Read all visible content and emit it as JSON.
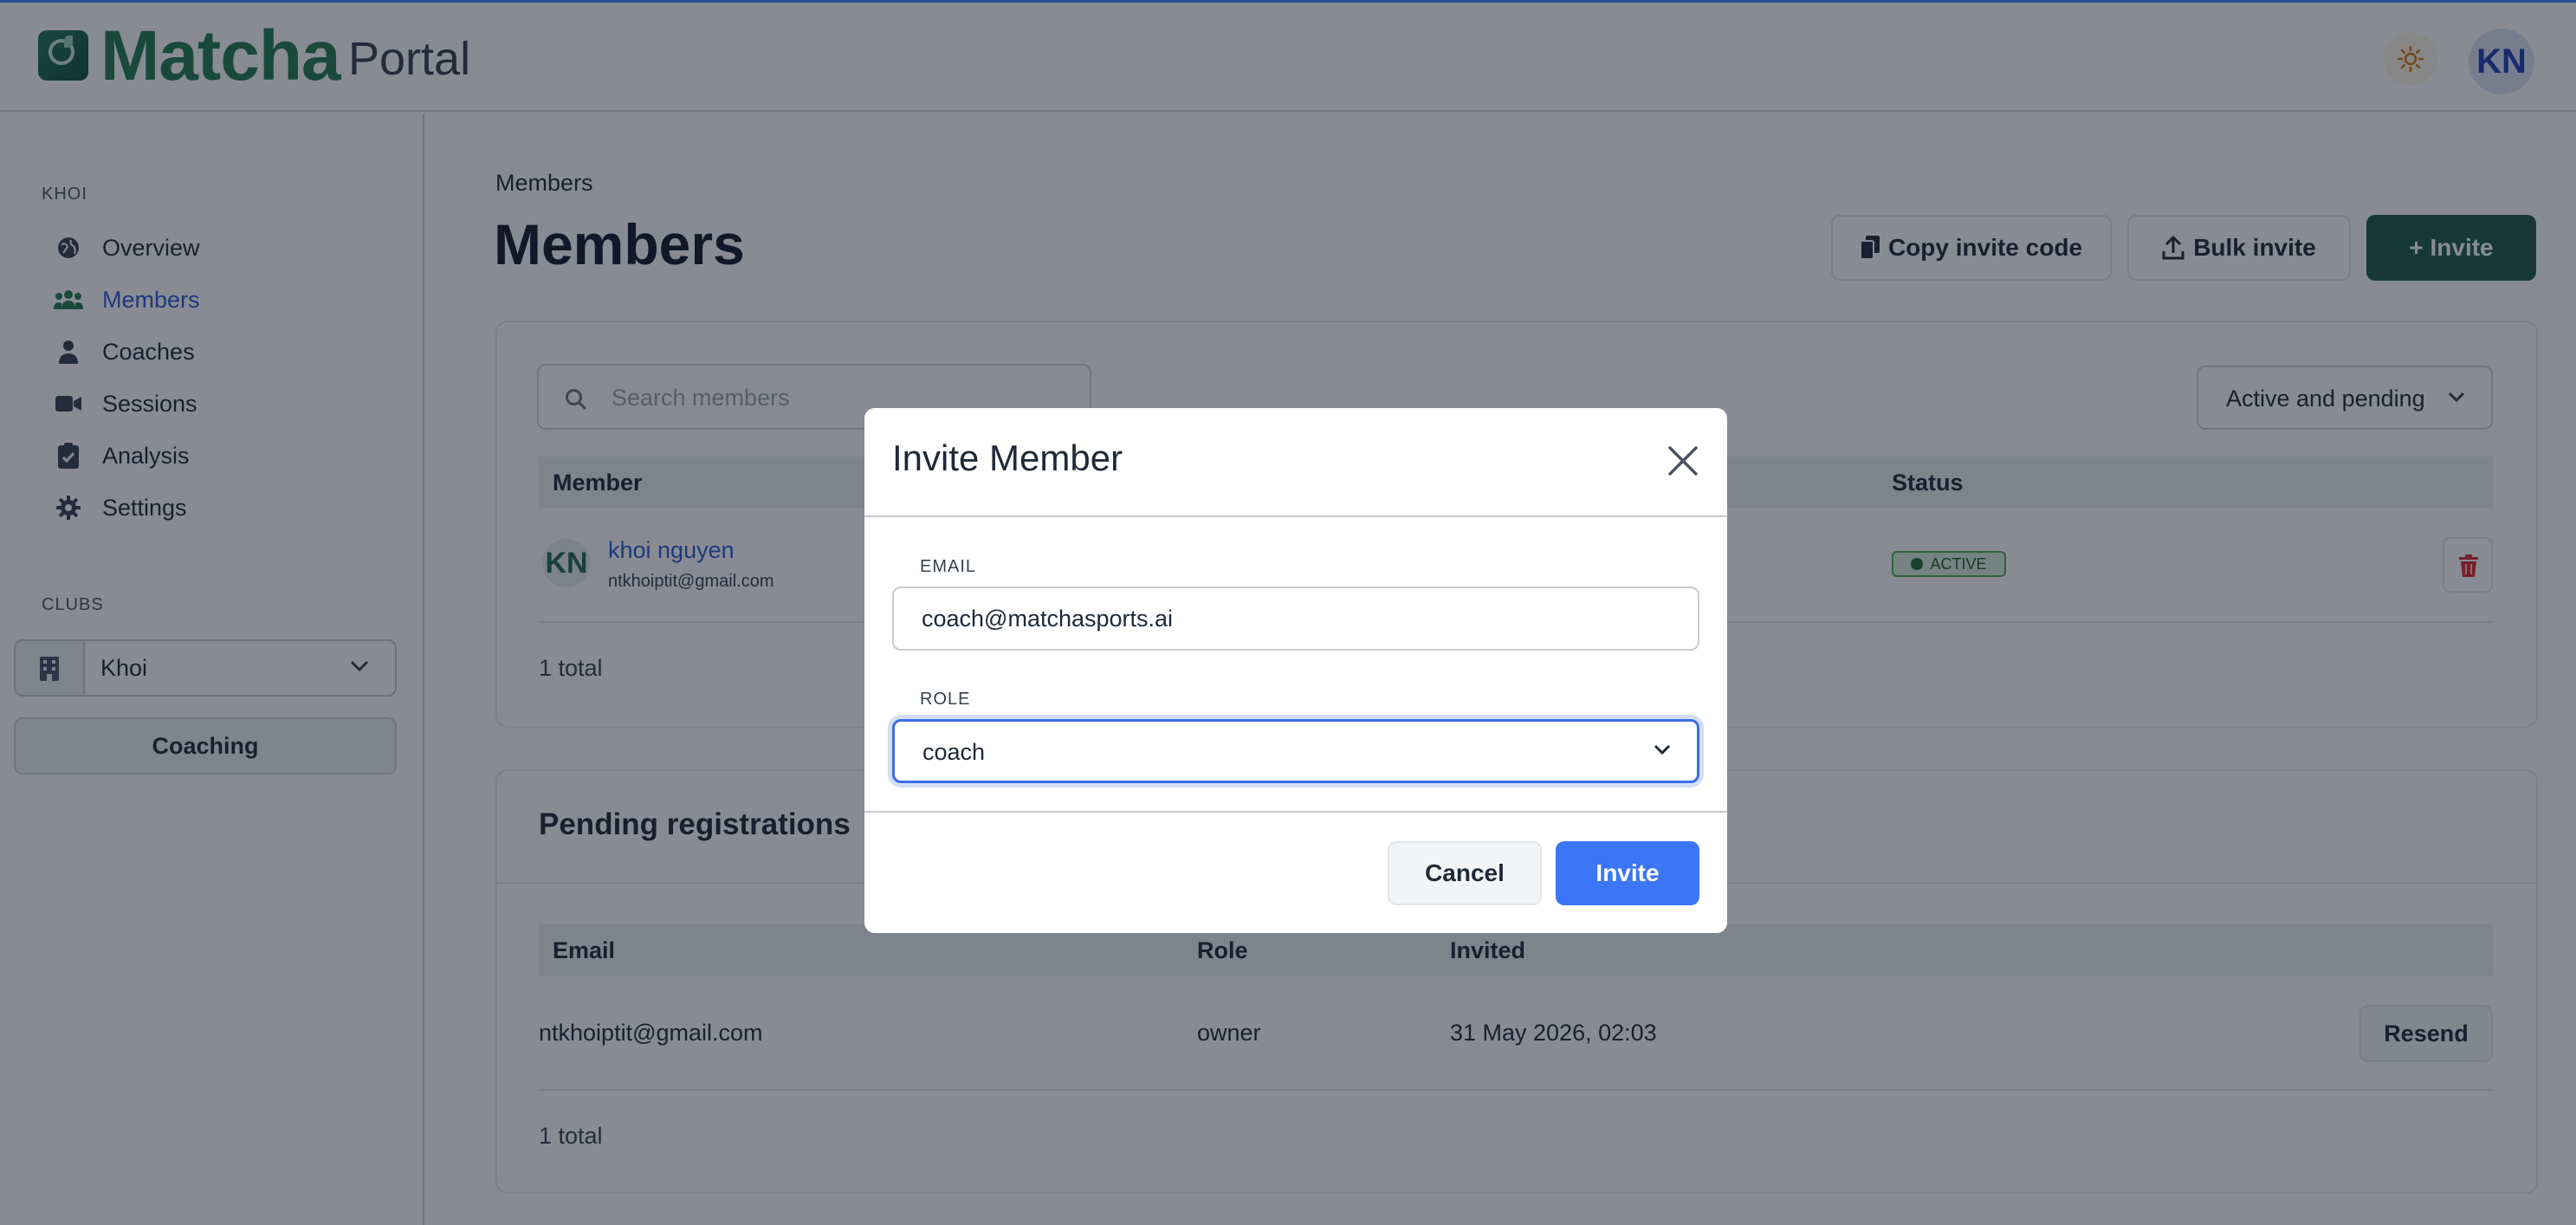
{
  "app": {
    "brand": "Matcha",
    "brand_sub": "Portal",
    "user_initials": "KN"
  },
  "sidebar": {
    "section_label": "KHOI",
    "items": [
      {
        "label": "Overview",
        "icon": "globe-icon"
      },
      {
        "label": "Members",
        "icon": "users-icon",
        "active": true
      },
      {
        "label": "Coaches",
        "icon": "user-icon"
      },
      {
        "label": "Sessions",
        "icon": "video-icon"
      },
      {
        "label": "Analysis",
        "icon": "clipboard-check-icon"
      },
      {
        "label": "Settings",
        "icon": "gear-icon"
      }
    ],
    "clubs_label": "CLUBS",
    "club_selected": "Khoi",
    "coaching_label": "Coaching"
  },
  "main": {
    "breadcrumb": "Members",
    "title": "Members",
    "actions": {
      "copy_invite": "Copy invite code",
      "bulk_invite": "Bulk invite",
      "invite": "+ Invite"
    },
    "members": {
      "search_placeholder": "Search members",
      "filter": "Active and pending",
      "columns": [
        "Member",
        "Status"
      ],
      "rows": [
        {
          "initials": "KN",
          "name": "khoi nguyen",
          "email": "ntkhoiptit@gmail.com",
          "status": "ACTIVE"
        }
      ],
      "total": "1 total"
    },
    "pending": {
      "title": "Pending registrations",
      "columns": [
        "Email",
        "Role",
        "Invited"
      ],
      "rows": [
        {
          "email": "ntkhoiptit@gmail.com",
          "role": "owner",
          "invited": "31 May 2026, 02:03",
          "action": "Resend"
        }
      ],
      "total": "1 total"
    }
  },
  "modal": {
    "title": "Invite Member",
    "email_label": "EMAIL",
    "email_value": "coach@matchasports.ai",
    "role_label": "ROLE",
    "role_value": "coach",
    "cancel": "Cancel",
    "submit": "Invite"
  },
  "colors": {
    "brand_green": "#1e7a4f",
    "accent_blue": "#3b76f6",
    "invite_green": "#1a5c3f",
    "status_active": "#4caf50",
    "danger": "#dc2626"
  }
}
